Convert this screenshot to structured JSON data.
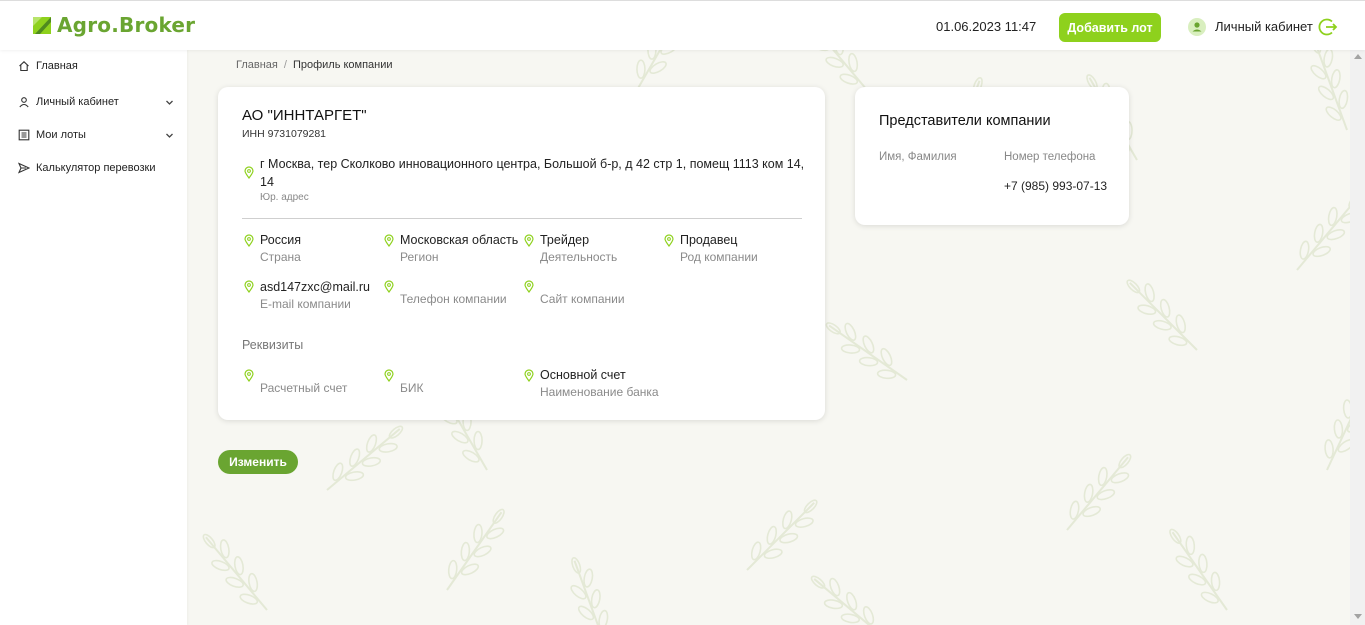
{
  "header": {
    "logo_text": "Agro.Broker",
    "datetime": "01.06.2023 11:47",
    "add_lot_label": "Добавить лот",
    "account_label": "Личный кабинет"
  },
  "sidebar": {
    "items": [
      {
        "label": "Главная",
        "icon": "home-icon"
      },
      {
        "label": "Личный кабинет",
        "icon": "user-icon"
      },
      {
        "label": "Мои лоты",
        "icon": "list-icon"
      },
      {
        "label": "Калькулятор перевозки",
        "icon": "send-icon"
      }
    ]
  },
  "breadcrumb": {
    "home": "Главная",
    "separator": "/",
    "current": "Профиль компании"
  },
  "company": {
    "name": "АО \"ИННТАРГЕТ\"",
    "inn": "ИНН 9731079281",
    "address": "г Москва, тер Сколково инновационного центра, Большой б-р, д 42 стр 1, помещ 1113 ком 14, 14",
    "address_label": "Юр. адрес",
    "fields": [
      {
        "value": "Россия",
        "label": "Страна"
      },
      {
        "value": "Московская область",
        "label": "Регион"
      },
      {
        "value": "Трейдер",
        "label": "Деятельность"
      },
      {
        "value": "Продавец",
        "label": "Род компании"
      },
      {
        "value": "asd147zxc@mail.ru",
        "label": "E-mail компании"
      },
      {
        "value": "",
        "label": "Телефон компании"
      },
      {
        "value": "",
        "label": "Сайт компании"
      }
    ],
    "requisites_title": "Реквизиты",
    "requisites": [
      {
        "value": "",
        "label": "Расчетный счет"
      },
      {
        "value": "",
        "label": "БИК"
      },
      {
        "value": "Основной счет",
        "label": "Наименование банка"
      }
    ]
  },
  "representatives": {
    "title": "Представители компании",
    "col_name": "Имя, Фамилия",
    "col_phone": "Номер телефона",
    "phone": "+7 (985) 993-07-13"
  },
  "edit_label": "Изменить",
  "colors": {
    "accent": "#8ed11d",
    "green_dark": "#6aa531",
    "pin": "#8ed11d",
    "background": "#f7f7f2"
  }
}
